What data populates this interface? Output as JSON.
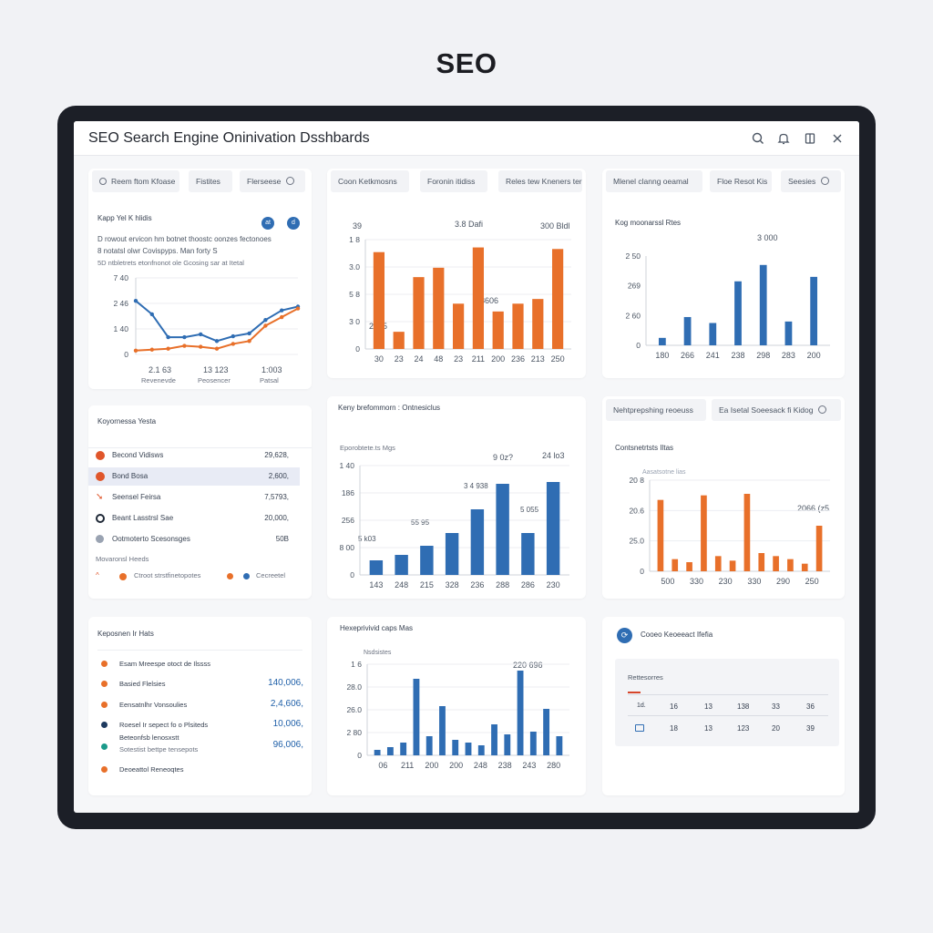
{
  "page_heading": "SEO",
  "window": {
    "title": "SEO Search Engine Oninivation Dsshbards",
    "controls": [
      {
        "name": "search-icon",
        "glyph": "⌕"
      },
      {
        "name": "bell-icon",
        "glyph": "🔔"
      },
      {
        "name": "book-icon",
        "glyph": "▯"
      },
      {
        "name": "close-icon",
        "glyph": "✕"
      }
    ]
  },
  "colors": {
    "orange": "#e8702a",
    "blue": "#2f6db3",
    "frame": "#1c1f27"
  },
  "panel1": {
    "chips": [
      "Reem ftom Kfoase",
      "Fistites",
      "Flerseese"
    ],
    "title": "Kapp Yel K hlidis",
    "badges": [
      "at",
      "d"
    ],
    "lines": [
      "D rowout ervicon hm botnet thoostc oonzes fectonoes",
      "8 notatsl olwr Covispyps. Man forty S",
      "5D ntbletrets etonfnonot ole Gcosing sar at Itetal"
    ],
    "footer": [
      {
        "value": "2.1 63",
        "label": "Revenevde"
      },
      {
        "value": "13 123",
        "label": "Peosencer"
      },
      {
        "value": "1:003",
        "label": "Patsal"
      }
    ]
  },
  "panel2": {
    "chips": [
      "Coon Ketkmosns",
      "Foronin itidiss",
      "Reles tew Kneners ter"
    ],
    "annotations": [
      "39",
      "3.8 Dafi",
      "300 Bldl",
      "2045",
      "8606"
    ]
  },
  "panel3": {
    "chips": [
      "Mlenel clanng oeamal",
      "Floe Resot Kis",
      "Seesies"
    ],
    "title": "Kog moonarssl Rtes",
    "annotations": [
      "3 000"
    ]
  },
  "panel4": {
    "title": "Koyornessa Yesta",
    "rows": [
      {
        "label": "Becond Vidisws",
        "value": "29,628,",
        "icon": "#e0562b"
      },
      {
        "label": "Bond Bosa",
        "value": "2,600,",
        "icon": "#e0562b"
      },
      {
        "label": "Seensel Feirsa",
        "value": "7,5793,",
        "icon": "#e0562b"
      },
      {
        "label": "Beant Lasstrsl Sae",
        "value": "20,000,",
        "icon": "#1f2937"
      },
      {
        "label": "Ootmoterto Scesonsges",
        "value": "50B",
        "icon": "#9aa3b2"
      }
    ],
    "subtitle": "Movaronsl Heeds",
    "legend": [
      "Ctroot strstfinetopotes",
      "Cecreetel"
    ]
  },
  "panel5": {
    "title": "Keny brefommorn : Ontnesiclus",
    "subtitle": "Eporobtete.ts Mgs",
    "annotations": [
      "9 0z?",
      "24 lo3",
      "3 4 938",
      "5 055",
      "55 95",
      "5 k03"
    ]
  },
  "panel6": {
    "chips": [
      "Nehtprepshing reoeuss",
      "Ea Isetal Soeesack fi Kidog"
    ],
    "title": "Contsnetrtsts Iltas",
    "legend": "Aasatsotne lias",
    "annotations": [
      "2066 (z5"
    ]
  },
  "panel7": {
    "title": "Keposnen Ir Hats",
    "items": [
      {
        "label": "Esam Mreespe otoct de Ilssss",
        "value": "",
        "dot": "#e8702a"
      },
      {
        "label": "Basied Flelsies",
        "value": "140,006,",
        "dot": "#e8702a"
      },
      {
        "label": "Eensatnlhr Vonsoulies",
        "value": "2,4,606,",
        "dot": "#e8702a"
      },
      {
        "label": "Roesel Ir sepect fo o Plsiteds",
        "value": "10,006,",
        "dot": "#1e3a5f"
      },
      {
        "label": "Beteonfsb lenosxstt",
        "value": "96,006,",
        "dot": "#1a9a8a"
      },
      {
        "label": "Sotestist bettpe tensepots",
        "value": "",
        "dot": ""
      },
      {
        "label": "Deoeattol Reneoqtes",
        "value": "",
        "dot": "#e8702a"
      }
    ]
  },
  "panel8": {
    "title": "Hexeprivivid caps Mas",
    "legend": "Nsdsistes",
    "annotations": [
      "220 696"
    ]
  },
  "panel9": {
    "title": "Cooeo Keoeeact Ifefia",
    "table_title": "Rettesorres",
    "row1": [
      "1d.",
      "16",
      "13",
      "138",
      "33",
      "36"
    ],
    "row2": [
      "",
      "18",
      "13",
      "123",
      "20",
      "39"
    ]
  },
  "chart_data": [
    {
      "type": "line",
      "panel": "panel1",
      "y_ticks": [
        "7 40",
        "2 46",
        "1 40",
        "0"
      ],
      "ylim": [
        0,
        8
      ],
      "series": [
        {
          "color": "#2f6db3",
          "values": [
            5.6,
            4.2,
            1.8,
            1.8,
            2.1,
            1.4,
            1.9,
            2.2,
            3.6,
            4.6,
            5.0
          ]
        },
        {
          "color": "#e8702a",
          "values": [
            0.4,
            0.5,
            0.6,
            0.9,
            0.8,
            0.6,
            1.1,
            1.4,
            3.0,
            3.9,
            4.8
          ]
        }
      ]
    },
    {
      "type": "bar",
      "panel": "panel2",
      "y_ticks": [
        "1 8",
        "3.0",
        "5 8",
        "3 0",
        "0"
      ],
      "x_ticks": [
        "30",
        "23",
        "24",
        "48",
        "23",
        "211",
        "200",
        "236",
        "213",
        "250"
      ],
      "ylim": [
        0,
        140
      ],
      "values": [
        124,
        22,
        92,
        104,
        58,
        130,
        48,
        58,
        64,
        128
      ]
    },
    {
      "type": "bar",
      "panel": "panel3",
      "y_ticks": [
        "2 50",
        "269",
        "2 60",
        "0"
      ],
      "x_ticks": [
        "180",
        "266",
        "241",
        "238",
        "298",
        "283",
        "200"
      ],
      "ylim": [
        0,
        120
      ],
      "values": [
        10,
        38,
        30,
        86,
        108,
        32,
        92
      ]
    },
    {
      "type": "bar",
      "panel": "panel5",
      "y_ticks": [
        "1 40",
        "186",
        "256",
        "8 00",
        "0"
      ],
      "x_ticks": [
        "143",
        "248",
        "215",
        "328",
        "236",
        "288",
        "286",
        "230"
      ],
      "ylim": [
        0,
        120
      ],
      "values": [
        16,
        22,
        32,
        46,
        72,
        100,
        46,
        102
      ]
    },
    {
      "type": "bar",
      "panel": "panel6",
      "y_ticks": [
        "20 8",
        "20.6",
        "25.0",
        "0"
      ],
      "x_ticks": [
        "500",
        "330",
        "230",
        "330",
        "290",
        "250"
      ],
      "ylim": [
        0,
        60
      ],
      "values": [
        47,
        8,
        6,
        50,
        10,
        7,
        51,
        12,
        10,
        8,
        5,
        30
      ]
    },
    {
      "type": "bar",
      "panel": "panel8",
      "y_ticks": [
        "1 6",
        "28.0",
        "26.0",
        "2 80",
        "0"
      ],
      "x_ticks": [
        "06",
        "211",
        "200",
        "200",
        "248",
        "238",
        "243",
        "280"
      ],
      "ylim": [
        0,
        100
      ],
      "values": [
        6,
        9,
        14,
        84,
        21,
        54,
        17,
        14,
        11,
        34,
        23,
        93,
        26,
        51,
        21
      ]
    }
  ]
}
